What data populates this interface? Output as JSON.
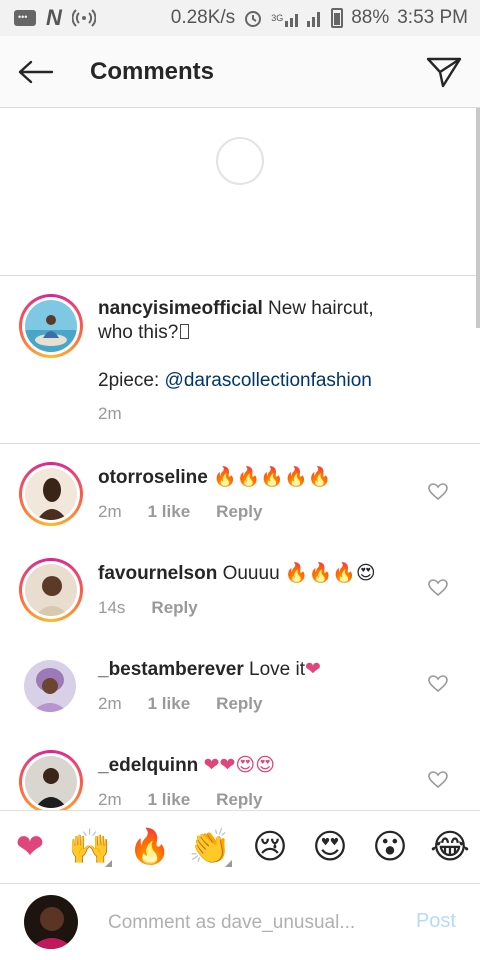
{
  "status_bar": {
    "speed": "0.28K/s",
    "network": "3G",
    "battery": "88%",
    "time": "3:53 PM"
  },
  "header": {
    "title": "Comments"
  },
  "caption": {
    "username": "nancyisimeofficial",
    "text_line1": " New haircut,",
    "text_line2": "who this?",
    "text_line3_prefix": "2piece: ",
    "mention": "@darascollectionfashion",
    "time": "2m"
  },
  "comments": [
    {
      "username": "otorroseline",
      "text": "",
      "emoji": "🔥🔥🔥🔥🔥",
      "time": "2m",
      "likes": "1 like",
      "reply": "Reply"
    },
    {
      "username": "favournelson",
      "text": " Ouuuu",
      "emoji": "🔥🔥🔥😍",
      "time": "14s",
      "likes": "",
      "reply": "Reply"
    },
    {
      "username": "_bestamberever",
      "text": " Love it",
      "emoji": "❤",
      "time": "2m",
      "likes": "1 like",
      "reply": "Reply"
    },
    {
      "username": "_edelquinn",
      "text": " ",
      "emoji": "❤❤😍😍",
      "time": "2m",
      "likes": "1 like",
      "reply": "Reply"
    }
  ],
  "emoji_bar": [
    "❤",
    "🙌",
    "🔥",
    "👏",
    "😢",
    "😍",
    "😮",
    "😂"
  ],
  "composer": {
    "placeholder": "Comment as dave_unusual...",
    "post_label": "Post"
  },
  "colors": {
    "accent_blue": "#b3dbff",
    "mention": "#003569",
    "ring_gradient": [
      "#d6249f",
      "#fd5949",
      "#fdbc2c"
    ]
  }
}
